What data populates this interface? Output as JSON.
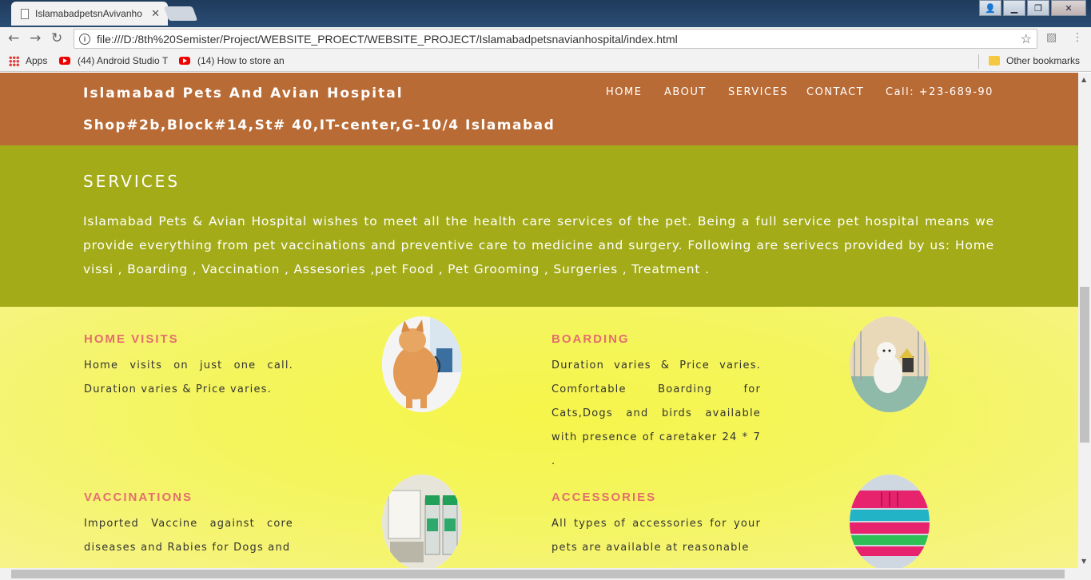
{
  "browser": {
    "tab_title": "IslamabadpetsnAvivanho",
    "url": "file:///D:/8th%20Semister/Project/WEBSITE_PROECT/WEBSITE_PROJECT/Islamabadpetsnavianhospital/index.html",
    "bookmarks": [
      {
        "label": "Apps",
        "icon": "apps-grid-icon"
      },
      {
        "label": "(44) Android Studio T",
        "icon": "youtube-icon"
      },
      {
        "label": "(14) How to store an",
        "icon": "youtube-icon"
      }
    ],
    "other_bookmarks": "Other bookmarks"
  },
  "header": {
    "brand": "Islamabad Pets And Avian Hospital",
    "address": "Shop#2b,Block#14,St# 40,IT-center,G-10/4 Islamabad",
    "nav": [
      "HOME",
      "ABOUT",
      "SERVICES",
      "CONTACT",
      "Call: +23-689-90"
    ]
  },
  "services": {
    "title": "SERVICES",
    "description": "Islamabad Pets & Avian Hospital wishes to meet all the health care services of the pet. Being a full service pet hospital means we provide everything from pet vaccinations and preventive care to medicine and surgery. Following are serivecs provided by us: Home vissi , Boarding , Vaccination , Assesories ,pet Food , Pet Grooming , Surgeries , Treatment ."
  },
  "cards": [
    {
      "title": "HOME VISITS",
      "text": "Home visits on just one call. Duration varies & Price varies.",
      "image": "cat-with-vet-photo"
    },
    {
      "title": "BOARDING",
      "text": "Duration varies & Price varies. Comfortable Boarding for Cats,Dogs and birds available with presence of caretaker 24 * 7 .",
      "image": "dog-in-kennel-photo"
    },
    {
      "title": "VACCINATIONS",
      "text": "Imported Vaccine against core diseases and Rabies for Dogs and",
      "image": "vaccine-vials-photo"
    },
    {
      "title": "ACCESSORIES",
      "text": "All types of accessories for your pets are available at reasonable",
      "image": "pet-carriers-photo"
    }
  ],
  "colors": {
    "header_bg": "#b96b35",
    "services_bg": "#a3ab18",
    "cards_bg": "#f6f54b",
    "card_title": "#e36e6e"
  }
}
